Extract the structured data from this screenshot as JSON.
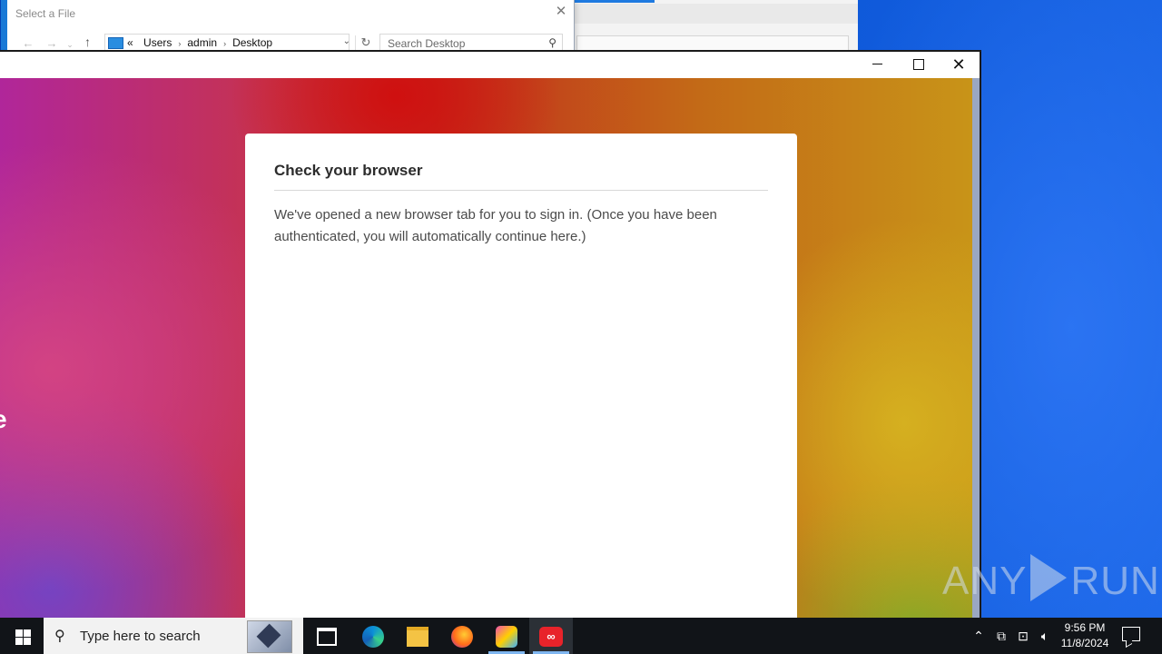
{
  "file_dialog": {
    "title": "Select a File",
    "close_icon": "close-icon",
    "nav_back_icon": "arrow-left-icon",
    "nav_forward_icon": "arrow-right-icon",
    "nav_up_icon": "arrow-up-icon",
    "path_prefix": "«",
    "breadcrumb": [
      "Users",
      "admin",
      "Desktop"
    ],
    "search_placeholder": "Search Desktop"
  },
  "adobe_window": {
    "card": {
      "title": "Check your browser",
      "message": "We've opened a new browser tab for you to sign in. (Once you have been authenticated, you will automatically continue here.)"
    },
    "partial_glyph": "e"
  },
  "watermark": {
    "left": "ANY",
    "right": "RUN"
  },
  "taskbar": {
    "search_placeholder": "Type here to search",
    "time": "9:56 PM",
    "date": "11/8/2024",
    "apps": [
      "task-view",
      "edge",
      "file-explorer",
      "firefox",
      "camera-app",
      "creative-cloud"
    ]
  },
  "colors": {
    "accent": "#1979d6",
    "adobe_red": "#e8232a"
  }
}
